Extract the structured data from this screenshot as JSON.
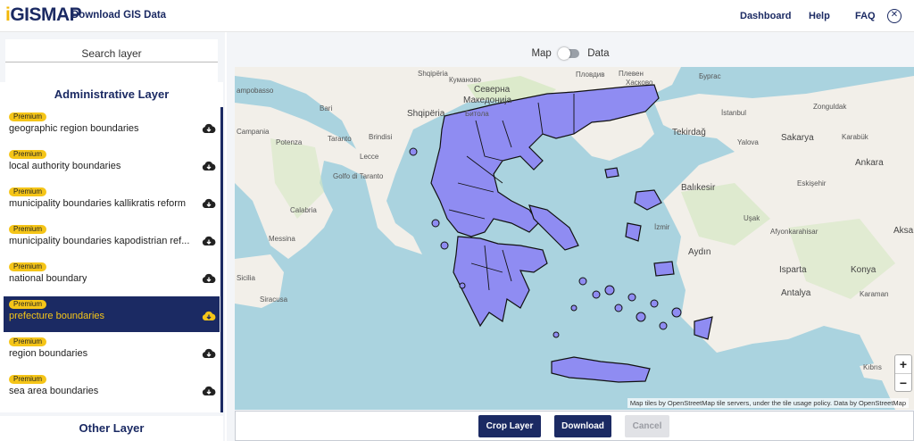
{
  "header": {
    "logo_prefix": "i",
    "logo_text": "GISMAP",
    "title": "Download GIS Data",
    "nav": [
      "Dashboard",
      "Help",
      "FAQ"
    ],
    "close_icon": "close-circle-icon"
  },
  "sidebar": {
    "search_placeholder": "Search layer",
    "admin_heading": "Administrative Layer",
    "other_heading": "Other Layer",
    "items": [
      {
        "badge": "Premium",
        "label": "geographic region boundaries",
        "selected": false
      },
      {
        "badge": "Premium",
        "label": "local authority boundaries",
        "selected": false
      },
      {
        "badge": "Premium",
        "label": "municipality boundaries kallikratis reform",
        "selected": false
      },
      {
        "badge": "Premium",
        "label": "municipality boundaries kapodistrian ref...",
        "selected": false
      },
      {
        "badge": "Premium",
        "label": "national boundary",
        "selected": false
      },
      {
        "badge": "Premium",
        "label": "prefecture boundaries",
        "selected": true
      },
      {
        "badge": "Premium",
        "label": "region boundaries",
        "selected": false
      },
      {
        "badge": "Premium",
        "label": "sea area boundaries",
        "selected": false
      }
    ],
    "download_icon": "cloud-download-icon"
  },
  "main": {
    "toggle_left": "Map",
    "toggle_right": "Data",
    "zoom_in": "+",
    "zoom_out": "−",
    "attribution": "Map tiles by OpenStreetMap tile servers, under the tile usage policy. Data by OpenStreetMap",
    "buttons": {
      "crop": "Crop Layer",
      "download": "Download",
      "cancel": "Cancel"
    },
    "labels": {
      "pleven": "Плевен",
      "campobasso": "ampobasso",
      "shqiperia_veriore": "Shqipëria",
      "kumanovo": "Куманово",
      "plovdiv": "Пловдив",
      "haskovo": "Хасково",
      "burgas": "Бургас",
      "severna": "Северна",
      "makedonija": "Македонија",
      "bari": "Bari",
      "shqiperia": "Shqipëria",
      "bitola": "Битола",
      "istanbul": "İstanbul",
      "zonguldak": "Zonguldak",
      "campania": "Campania",
      "potenza": "Potenza",
      "taranto": "Taranto",
      "brindisi": "Brindisi",
      "lecce": "Lecce",
      "tekirdag": "Tekirdağ",
      "yalova": "Yalova",
      "sakarya": "Sakarya",
      "karabuk": "Karabük",
      "ankara": "Ankara",
      "balikesir": "Balıkesir",
      "eskisehir": "Eskişehir",
      "usak": "Uşak",
      "afyon": "Afyonkarahisar",
      "izmir": "İzmir",
      "aksa": "Aksa",
      "aydin": "Aydın",
      "isparta": "Isparta",
      "konya": "Konya",
      "antalya": "Antalya",
      "karaman": "Karaman",
      "messina": "Messina",
      "siracusa": "Siracusa",
      "calabria": "Calabria",
      "golfo": "Golfo di Taranto",
      "kibris": "Kıbrıs",
      "sicilia": "Sicilia"
    }
  },
  "colors": {
    "brand": "#1b2a63",
    "accent": "#f5c518",
    "sea": "#aad3df",
    "land": "#f2efe9",
    "greece": "#8f8cf2"
  }
}
